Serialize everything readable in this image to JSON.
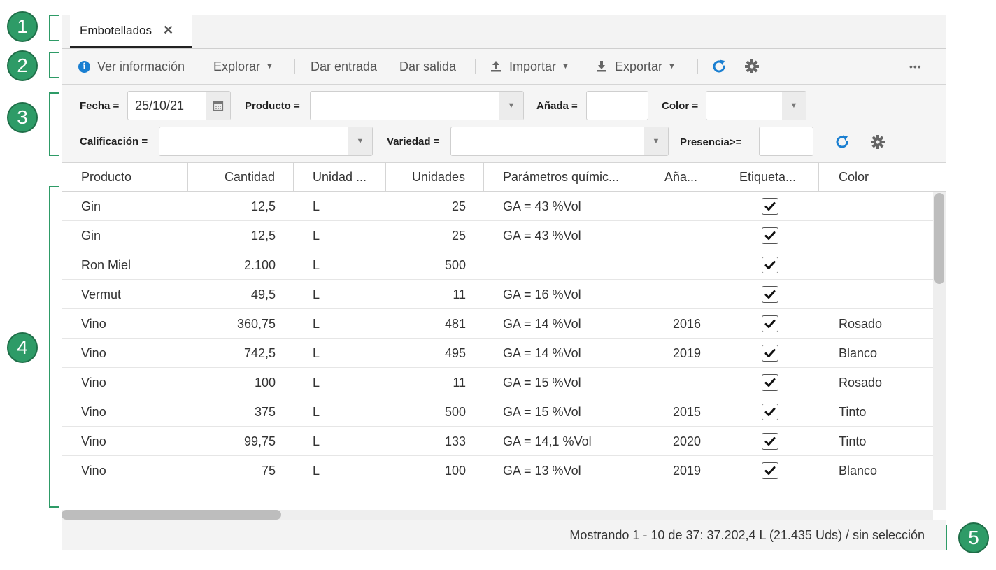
{
  "callouts": [
    "1",
    "2",
    "3",
    "4",
    "5"
  ],
  "tab": {
    "title": "Embotellados",
    "close_icon": "close-icon"
  },
  "toolbar": {
    "info": "Ver información",
    "explore": "Explorar",
    "entry": "Dar entrada",
    "exit": "Dar salida",
    "import": "Importar",
    "export": "Exportar",
    "refresh_icon": "refresh-icon",
    "settings_icon": "gear-icon",
    "more": "•••"
  },
  "filters": {
    "fecha_label": "Fecha =",
    "fecha_value": "25/10/21",
    "producto_label": "Producto =",
    "producto_value": "",
    "anada_label": "Añada =",
    "anada_value": "",
    "color_label": "Color =",
    "color_value": "",
    "calificacion_label": "Calificación =",
    "calificacion_value": "",
    "variedad_label": "Variedad =",
    "variedad_value": "",
    "presencia_label": "Presencia>=",
    "presencia_value": ""
  },
  "table": {
    "columns": [
      "Producto",
      "Cantidad",
      "Unidad ...",
      "Unidades",
      "Parámetros químic...",
      "Aña...",
      "Etiqueta...",
      "Color"
    ],
    "rows": [
      {
        "producto": "Gin",
        "cantidad": "12,5",
        "unidad": "L",
        "unidades": "25",
        "param": "GA = 43 %Vol",
        "anada": "",
        "etiqueta": true,
        "color": ""
      },
      {
        "producto": "Gin",
        "cantidad": "12,5",
        "unidad": "L",
        "unidades": "25",
        "param": "GA = 43 %Vol",
        "anada": "",
        "etiqueta": true,
        "color": ""
      },
      {
        "producto": "Ron Miel",
        "cantidad": "2.100",
        "unidad": "L",
        "unidades": "500",
        "param": "",
        "anada": "",
        "etiqueta": true,
        "color": ""
      },
      {
        "producto": "Vermut",
        "cantidad": "49,5",
        "unidad": "L",
        "unidades": "11",
        "param": "GA = 16 %Vol",
        "anada": "",
        "etiqueta": true,
        "color": ""
      },
      {
        "producto": "Vino",
        "cantidad": "360,75",
        "unidad": "L",
        "unidades": "481",
        "param": "GA = 14 %Vol",
        "anada": "2016",
        "etiqueta": true,
        "color": "Rosado"
      },
      {
        "producto": "Vino",
        "cantidad": "742,5",
        "unidad": "L",
        "unidades": "495",
        "param": "GA = 14 %Vol",
        "anada": "2019",
        "etiqueta": true,
        "color": "Blanco"
      },
      {
        "producto": "Vino",
        "cantidad": "100",
        "unidad": "L",
        "unidades": "11",
        "param": "GA = 15 %Vol",
        "anada": "",
        "etiqueta": true,
        "color": "Rosado"
      },
      {
        "producto": "Vino",
        "cantidad": "375",
        "unidad": "L",
        "unidades": "500",
        "param": "GA = 15 %Vol",
        "anada": "2015",
        "etiqueta": true,
        "color": "Tinto"
      },
      {
        "producto": "Vino",
        "cantidad": "99,75",
        "unidad": "L",
        "unidades": "133",
        "param": "GA = 14,1 %Vol",
        "anada": "2020",
        "etiqueta": true,
        "color": "Tinto"
      },
      {
        "producto": "Vino",
        "cantidad": "75",
        "unidad": "L",
        "unidades": "100",
        "param": "GA = 13 %Vol",
        "anada": "2019",
        "etiqueta": true,
        "color": "Blanco"
      }
    ]
  },
  "status": {
    "text": "Mostrando 1 - 10 de 37: 37.202,4 L (21.435 Uds) / sin selección"
  },
  "colors": {
    "accent": "#1a7fd1",
    "callout": "#2e9b67"
  }
}
